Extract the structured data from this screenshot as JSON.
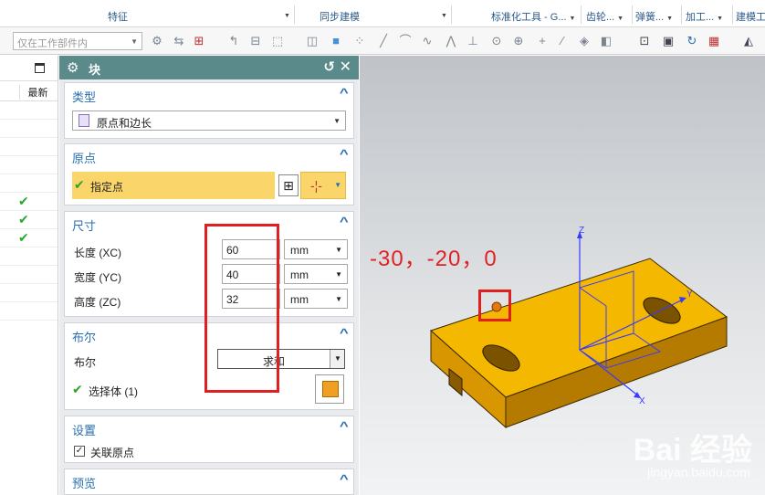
{
  "ribbon": {
    "groups": [
      {
        "label": "特征"
      },
      {
        "label": "同步建模"
      },
      {
        "label": "标准化工具 - G..."
      },
      {
        "label": "齿轮..."
      },
      {
        "label": "弹簧..."
      },
      {
        "label": "加工..."
      },
      {
        "label": "建模工"
      }
    ]
  },
  "toolbar": {
    "scope_placeholder": "仅在工作部件内"
  },
  "history": {
    "column_header": "最新",
    "checks": [
      "✔",
      "✔",
      "✔"
    ]
  },
  "dialog": {
    "title": "块",
    "sections": {
      "type": {
        "title": "类型",
        "selected": "原点和边长"
      },
      "origin": {
        "title": "原点",
        "specify_point": "指定点"
      },
      "dimensions": {
        "title": "尺寸",
        "length_label": "长度 (XC)",
        "length_value": "60",
        "width_label": "宽度 (YC)",
        "width_value": "40",
        "height_label": "高度 (ZC)",
        "height_value": "32",
        "unit": "mm"
      },
      "boolean": {
        "title": "布尔",
        "label": "布尔",
        "value": "求和",
        "select_body": "选择体 (1)"
      },
      "settings": {
        "title": "设置",
        "associative_origin": "关联原点"
      },
      "preview": {
        "title": "预览"
      }
    }
  },
  "viewport": {
    "coord_annotation": "-30，-20，0",
    "axis_z": "Z",
    "axis_y": "Y",
    "axis_x": "X",
    "part_color": "#f5b800",
    "watermark": "Bai 经验",
    "watermark_url": "jingyan.baidu.com"
  },
  "colors": {
    "title_bar": "#5b8a8a",
    "section_title": "#2a6fb0",
    "specify_point_bg": "#fad56a",
    "annotation_red": "#e02020"
  }
}
